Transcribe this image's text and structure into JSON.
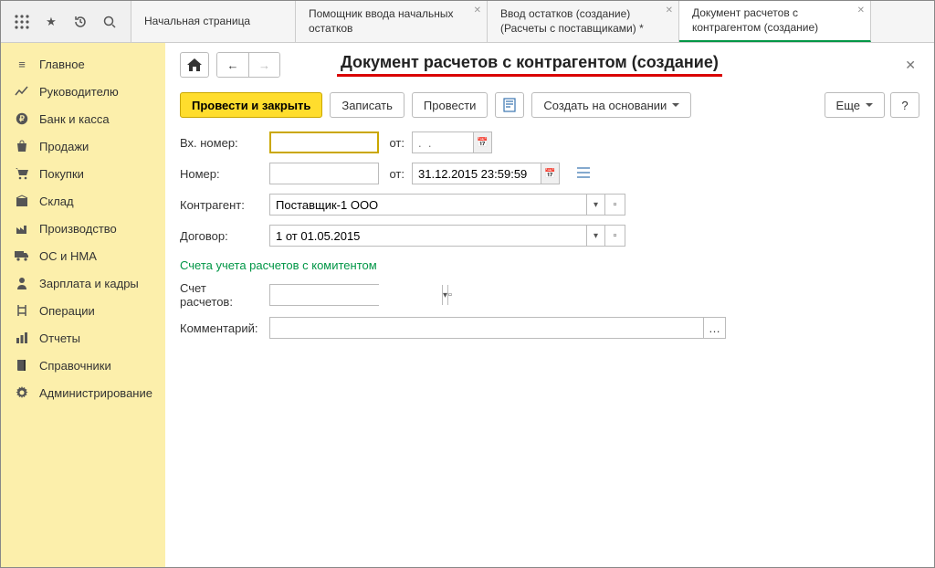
{
  "tabs": [
    {
      "label": "Начальная страница",
      "closable": false
    },
    {
      "label": "Помощник ввода начальных остатков",
      "closable": true
    },
    {
      "label": "Ввод остатков (создание) (Расчеты с поставщиками) *",
      "closable": true
    },
    {
      "label": "Документ расчетов с контрагентом (создание)",
      "closable": true,
      "active": true
    }
  ],
  "sidebar": {
    "items": [
      {
        "icon": "menu",
        "label": "Главное"
      },
      {
        "icon": "trend",
        "label": "Руководителю"
      },
      {
        "icon": "ruble",
        "label": "Банк и касса"
      },
      {
        "icon": "bag",
        "label": "Продажи"
      },
      {
        "icon": "cart",
        "label": "Покупки"
      },
      {
        "icon": "box",
        "label": "Склад"
      },
      {
        "icon": "factory",
        "label": "Производство"
      },
      {
        "icon": "truck",
        "label": "ОС и НМА"
      },
      {
        "icon": "person",
        "label": "Зарплата и кадры"
      },
      {
        "icon": "ops",
        "label": "Операции"
      },
      {
        "icon": "chart",
        "label": "Отчеты"
      },
      {
        "icon": "book",
        "label": "Справочники"
      },
      {
        "icon": "gear",
        "label": "Администрирование"
      }
    ]
  },
  "page": {
    "title": "Документ расчетов с контрагентом (создание)"
  },
  "actions": {
    "post_close": "Провести и закрыть",
    "save": "Записать",
    "post": "Провести",
    "create_based": "Создать на основании",
    "more": "Еще",
    "help": "?"
  },
  "form": {
    "incoming_number_label": "Вх. номер:",
    "incoming_number": "",
    "from_label": "от:",
    "incoming_date_placeholder": ".  .",
    "number_label": "Номер:",
    "number": "",
    "date": "31.12.2015 23:59:59",
    "counterparty_label": "Контрагент:",
    "counterparty": "Поставщик-1 ООО",
    "contract_label": "Договор:",
    "contract": "1 от 01.05.2015",
    "section_link": "Счета учета расчетов с комитентом",
    "account_label": "Счет расчетов:",
    "account": "",
    "comment_label": "Комментарий:",
    "comment": ""
  }
}
